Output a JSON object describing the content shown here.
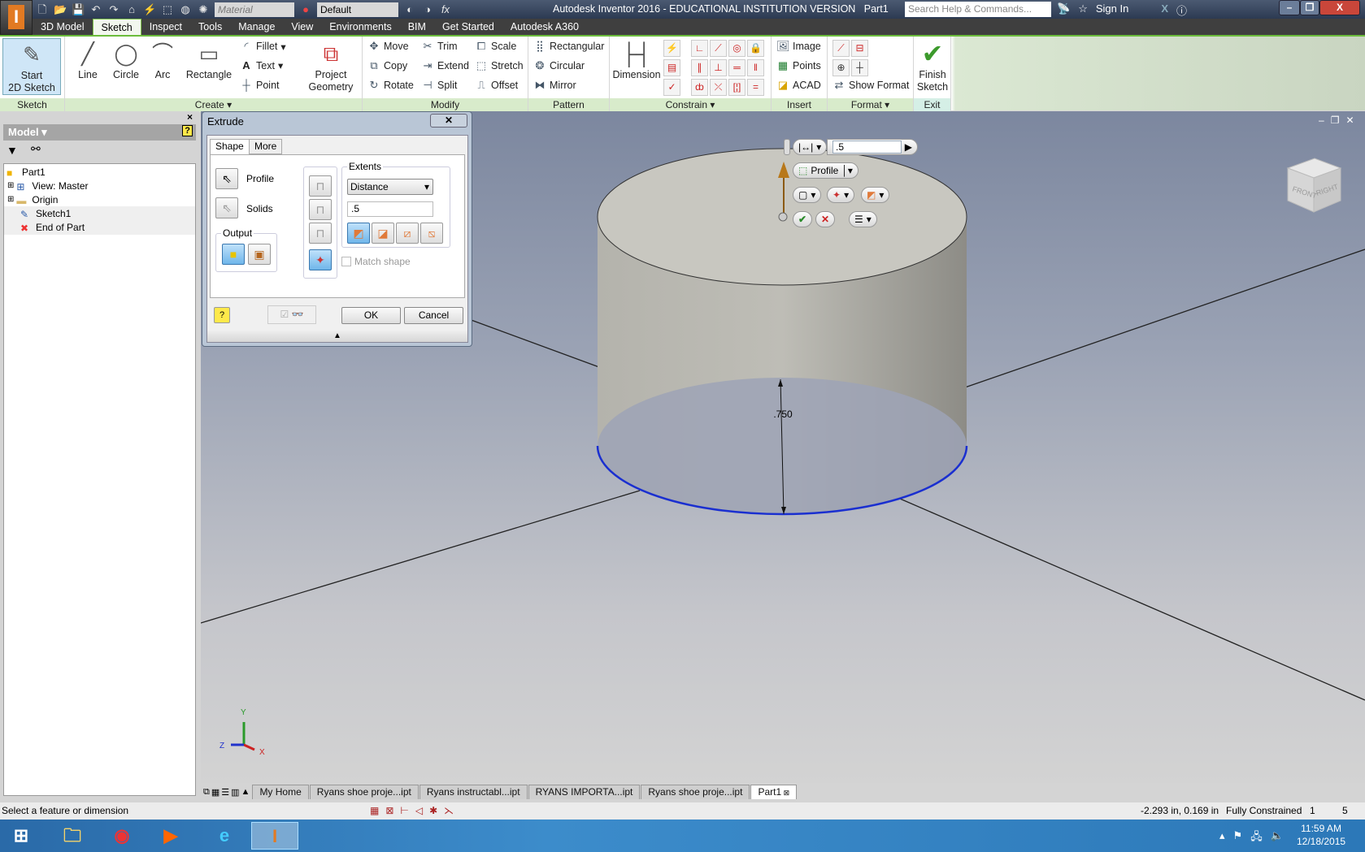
{
  "title_bar": {
    "title": "Autodesk Inventor 2016 - EDUCATIONAL INSTITUTION VERSION",
    "document": "Part1",
    "material_placeholder": "Material",
    "appearance": "Default",
    "search_placeholder": "Search Help & Commands...",
    "sign_in": "Sign In"
  },
  "ribbon_tabs": [
    "3D Model",
    "Sketch",
    "Inspect",
    "Tools",
    "Manage",
    "View",
    "Environments",
    "BIM",
    "Get Started",
    "Autodesk A360"
  ],
  "active_tab": "Sketch",
  "ribbon": {
    "sketch": {
      "label": "Sketch",
      "start": "Start\n2D Sketch"
    },
    "create": {
      "label": "Create",
      "line": "Line",
      "circle": "Circle",
      "arc": "Arc",
      "rectangle": "Rectangle",
      "fillet": "Fillet",
      "text": "Text",
      "point": "Point",
      "project": "Project\nGeometry"
    },
    "modify": {
      "label": "Modify",
      "move": "Move",
      "copy": "Copy",
      "rotate": "Rotate",
      "trim": "Trim",
      "extend": "Extend",
      "split": "Split",
      "scale": "Scale",
      "stretch": "Stretch",
      "offset": "Offset"
    },
    "pattern": {
      "label": "Pattern",
      "rectangular": "Rectangular",
      "circular": "Circular",
      "mirror": "Mirror"
    },
    "constrain": {
      "label": "Constrain",
      "dimension": "Dimension"
    },
    "insert": {
      "label": "Insert",
      "image": "Image",
      "points": "Points",
      "acad": "ACAD"
    },
    "format": {
      "label": "Format",
      "show_format": "Show Format"
    },
    "exit": {
      "label": "Exit",
      "finish": "Finish\nSketch"
    }
  },
  "browser": {
    "title": "Model",
    "tree": [
      {
        "label": "Part1",
        "icon": "part-icon"
      },
      {
        "label": "View: Master",
        "icon": "view-icon"
      },
      {
        "label": "Origin",
        "icon": "folder-icon"
      },
      {
        "label": "Sketch1",
        "icon": "sketch-icon"
      },
      {
        "label": "End of Part",
        "icon": "end-of-part-icon"
      }
    ]
  },
  "extrude_dialog": {
    "title": "Extrude",
    "tabs": [
      "Shape",
      "More"
    ],
    "profile": "Profile",
    "solids": "Solids",
    "output": "Output",
    "extents": "Extents",
    "extents_type": "Distance",
    "distance": ".5",
    "match_shape": "Match shape",
    "ok": "OK",
    "cancel": "Cancel"
  },
  "mini_toolbar": {
    "distance": ".5",
    "profile": "Profile"
  },
  "viewport": {
    "dimension": ".750",
    "viewcube": {
      "front": "FRONT",
      "right": "RIGHT"
    },
    "axes": {
      "x": "X",
      "y": "Y",
      "z": "Z"
    }
  },
  "document_tabs": [
    "My Home",
    "Ryans shoe proje...ipt",
    "Ryans instructabl...ipt",
    "RYANS IMPORTA...ipt",
    "Ryans shoe proje...ipt",
    "Part1"
  ],
  "active_document": "Part1",
  "status_bar": {
    "message": "Select a feature or dimension",
    "coordinates": "-2.293 in, 0.169 in",
    "constraint": "Fully Constrained",
    "count1": "1",
    "count2": "5"
  },
  "taskbar": {
    "time": "11:59 AM",
    "date": "12/18/2015"
  },
  "colors": {
    "ribbon_accent": "#6cbc3c",
    "profile_edge": "#1a2fd0",
    "taskbar": "#2c78b8"
  }
}
